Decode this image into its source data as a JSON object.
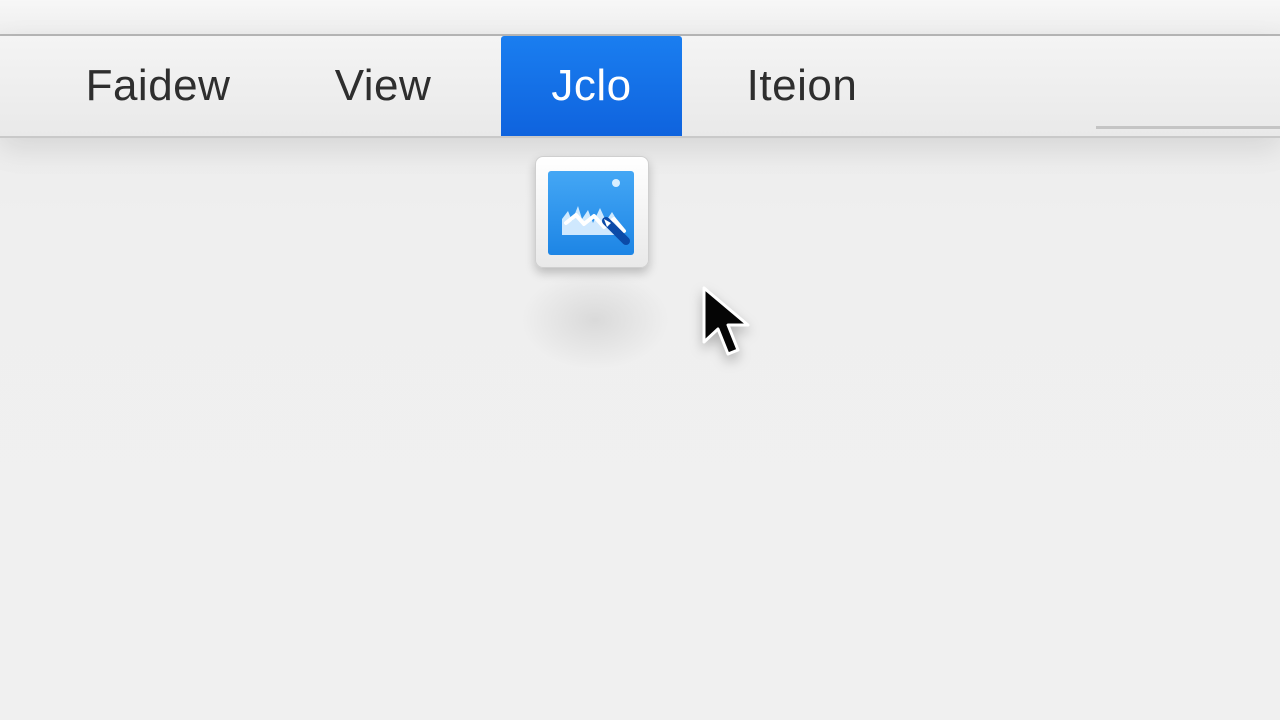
{
  "menubar": {
    "items": [
      {
        "label": "Faidew"
      },
      {
        "label": "View"
      },
      {
        "label": "Jclo",
        "selected": true
      },
      {
        "label": "Iteion"
      }
    ]
  },
  "dropdown": {
    "icon": "app-image-icon"
  },
  "cursor": {
    "icon": "arrow-pointer-icon"
  },
  "colors": {
    "selected_menu_bg": "#1470e6",
    "selected_menu_text": "#ffffff",
    "menu_text": "#2e2e2e",
    "background": "#eeeeee"
  }
}
